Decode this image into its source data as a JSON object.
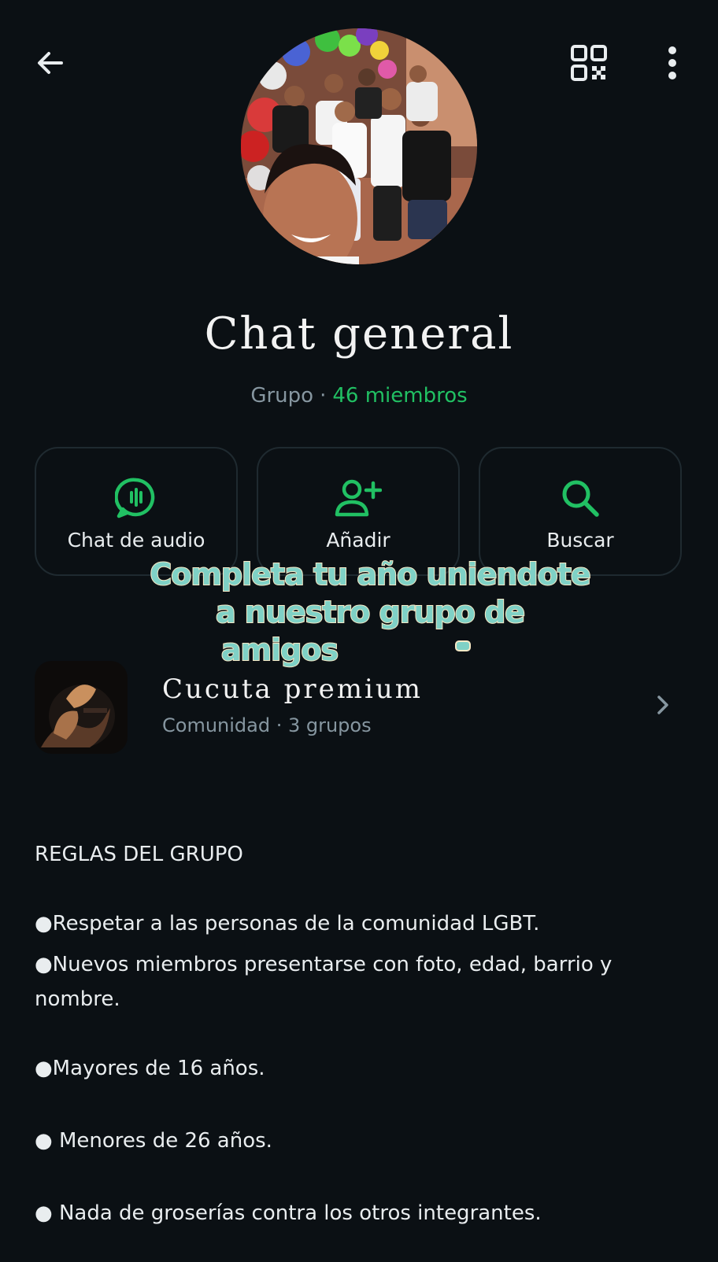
{
  "header": {
    "back_icon": "arrow-left-icon",
    "qr_icon": "qr-code-icon",
    "more_icon": "more-vertical-icon"
  },
  "group": {
    "title": "Chat general",
    "type": "Grupo",
    "separator": "·",
    "members": "46 miembros"
  },
  "actions": [
    {
      "label": "Chat de audio",
      "icon": "audio-chat-icon"
    },
    {
      "label": "Añadir",
      "icon": "add-person-icon"
    },
    {
      "label": "Buscar",
      "icon": "search-icon"
    }
  ],
  "overlay": {
    "line1": "Completa tu año uniendote",
    "line2": "a nuestro grupo de",
    "line3": "amigos"
  },
  "community": {
    "name": "Cucuta premium",
    "meta": "Comunidad · 3 grupos",
    "chevron_icon": "chevron-right-icon"
  },
  "description": {
    "heading": "REGLAS DEL GRUPO",
    "rule1": "●Respetar a las personas de la comunidad LGBT.",
    "rule2a": "●Nuevos miembros presentarse con foto, edad, barrio y",
    "rule2b": "nombre.",
    "rule3": "●Mayores de 16 años.",
    "rule4": "● Menores de 26 años.",
    "rule5": "● Nada de groserías contra los otros integrantes."
  },
  "colors": {
    "background": "#0b1014",
    "accent": "#21c063",
    "secondary_text": "#8696a0",
    "card_border": "#1f2a30"
  }
}
